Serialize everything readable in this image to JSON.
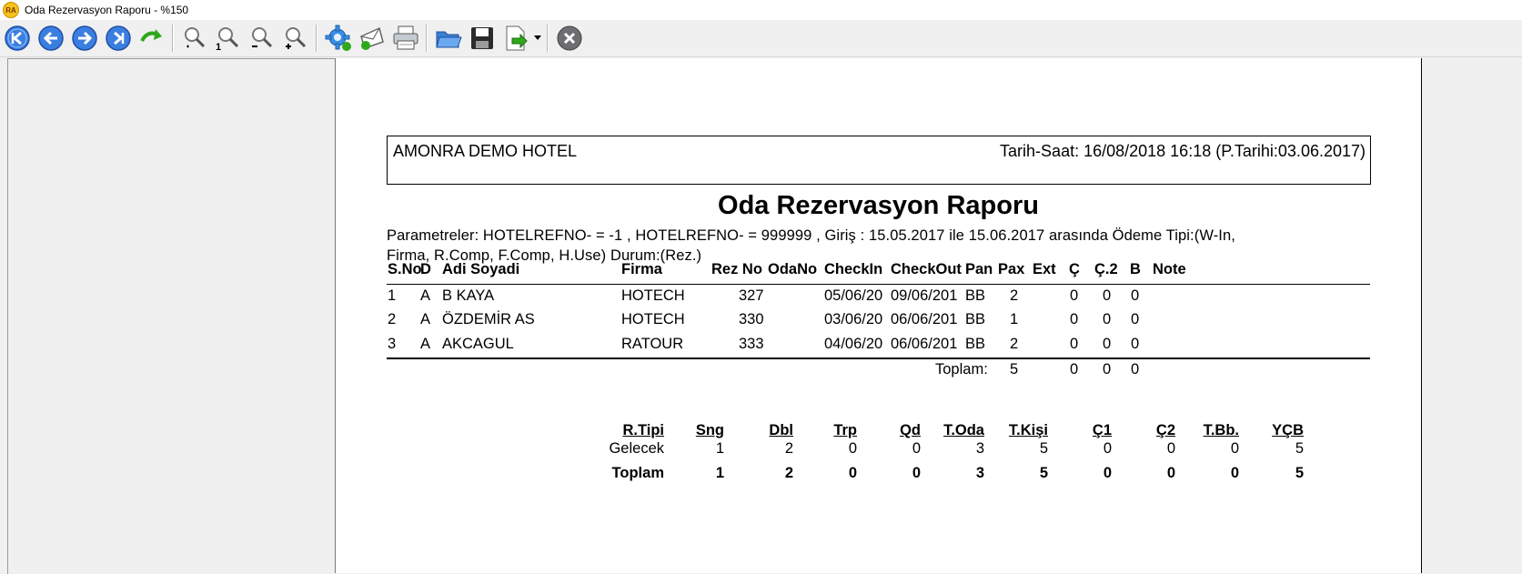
{
  "window": {
    "title": "Oda Rezervasyon Raporu - %150",
    "logo_text": "RA"
  },
  "toolbar": {
    "buttons": [
      {
        "name": "first-page",
        "icon": "first-page-icon"
      },
      {
        "name": "previous-page",
        "icon": "previous-page-icon"
      },
      {
        "name": "next-page",
        "icon": "next-page-icon"
      },
      {
        "name": "last-page",
        "icon": "last-page-icon"
      },
      {
        "name": "goto-page",
        "icon": "goto-arrow-icon"
      },
      {
        "name": "zoom-fit",
        "icon": "zoom-fit-icon"
      },
      {
        "name": "zoom-actual",
        "icon": "zoom-actual-icon"
      },
      {
        "name": "zoom-out",
        "icon": "zoom-out-icon"
      },
      {
        "name": "zoom-in",
        "icon": "zoom-in-icon"
      },
      {
        "name": "settings",
        "icon": "gear-icon"
      },
      {
        "name": "send-mail",
        "icon": "mail-icon"
      },
      {
        "name": "print",
        "icon": "printer-icon"
      },
      {
        "name": "open",
        "icon": "folder-icon"
      },
      {
        "name": "save",
        "icon": "floppy-icon"
      },
      {
        "name": "export",
        "icon": "export-icon"
      },
      {
        "name": "close",
        "icon": "close-icon"
      }
    ],
    "zoom_actual_label": "1",
    "colors": {
      "nav_blue": "#3a7fe0",
      "green_arrow": "#2fa81c",
      "close_gray": "#6d6d72"
    }
  },
  "report": {
    "hotel": "AMONRA DEMO HOTEL",
    "datetime": "Tarih-Saat: 16/08/2018 16:18 (P.Tarihi:03.06.2017)",
    "title": "Oda Rezervasyon Raporu",
    "params_line1": "Parametreler: HOTELREFNO- = -1 , HOTELREFNO- = 999999 , Giriş : 15.05.2017 ile 15.06.2017 arasında  Ödeme Tipi:(W-In,",
    "params_line2": "Firma, R.Comp, F.Comp, H.Use) Durum:(Rez.)",
    "columns": {
      "sno": "S.No",
      "d": "D",
      "name": "Adi Soyadi",
      "firma": "Firma",
      "rezno": "Rez No",
      "odano": "OdaNo",
      "checkin": "CheckIn",
      "checkout": "CheckOut",
      "pan": "Pan",
      "pax": "Pax",
      "ext": "Ext",
      "c": "Ç",
      "c2": "Ç.2",
      "b": "B",
      "note": "Note"
    },
    "rows": [
      {
        "sno": "1",
        "d": "A",
        "name": "B KAYA",
        "firma": "HOTECH",
        "rezno": "327",
        "odano": "",
        "checkin": "05/06/20",
        "checkout": "09/06/201",
        "pan": "BB",
        "pax": "2",
        "ext": "",
        "c": "0",
        "c2": "0",
        "b": "0",
        "note": ""
      },
      {
        "sno": "2",
        "d": "A",
        "name": "ÖZDEMİR AS",
        "firma": "HOTECH",
        "rezno": "330",
        "odano": "",
        "checkin": "03/06/20",
        "checkout": "06/06/201",
        "pan": "BB",
        "pax": "1",
        "ext": "",
        "c": "0",
        "c2": "0",
        "b": "0",
        "note": ""
      },
      {
        "sno": "3",
        "d": "A",
        "name": " AKCAGUL",
        "firma": "RATOUR",
        "rezno": "333",
        "odano": "",
        "checkin": "04/06/20",
        "checkout": "06/06/201",
        "pan": "BB",
        "pax": "2",
        "ext": "",
        "c": "0",
        "c2": "0",
        "b": "0",
        "note": ""
      }
    ],
    "total": {
      "label": "Toplam:",
      "pax": "5",
      "c": "0",
      "c2": "0",
      "b": "0"
    },
    "summary": {
      "headers": [
        "R.Tipi",
        "Sng",
        "Dbl",
        "Trp",
        "Qd",
        "T.Oda",
        "T.Kişi",
        "Ç1",
        "Ç2",
        "T.Bb.",
        "YÇB"
      ],
      "rows": [
        [
          "Gelecek",
          "1",
          "2",
          "0",
          "0",
          "3",
          "5",
          "0",
          "0",
          "0",
          "5"
        ]
      ],
      "total": [
        "Toplam",
        "1",
        "2",
        "0",
        "0",
        "3",
        "5",
        "0",
        "0",
        "0",
        "5"
      ]
    }
  }
}
